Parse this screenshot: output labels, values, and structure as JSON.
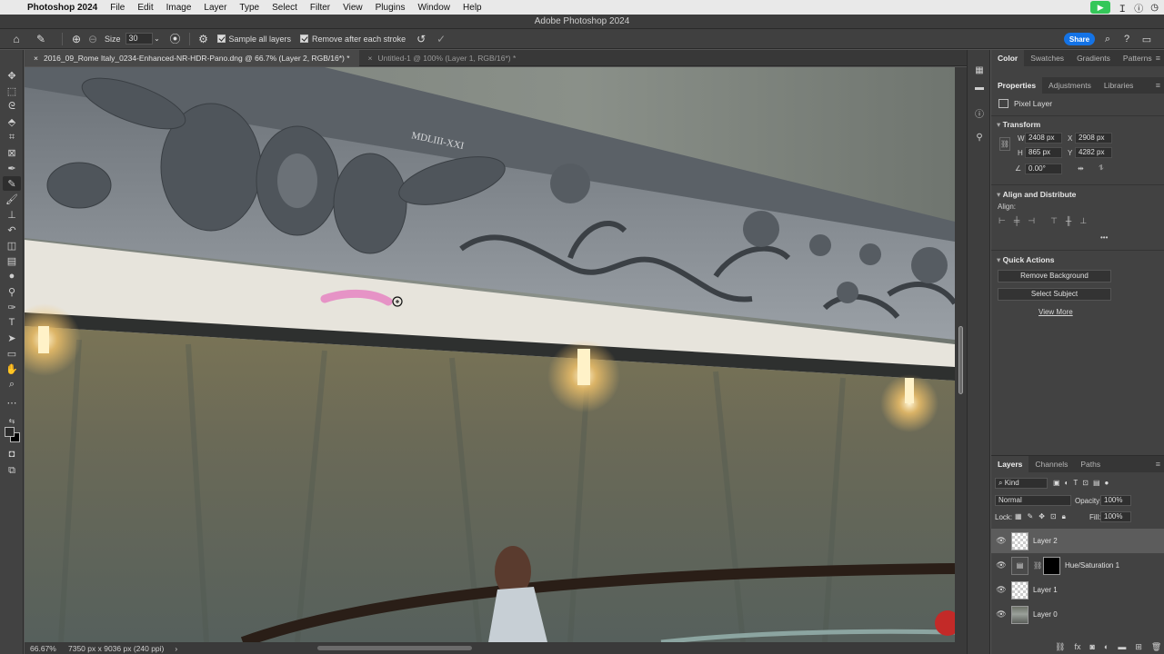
{
  "menubar": {
    "app_name": "Photoshop 2024",
    "items": [
      "File",
      "Edit",
      "Image",
      "Layer",
      "Type",
      "Select",
      "Filter",
      "View",
      "Plugins",
      "Window",
      "Help"
    ]
  },
  "window_title": "Adobe Photoshop 2024",
  "options_bar": {
    "size_label": "Size",
    "size_value": "30",
    "sample_all_layers": "Sample all layers",
    "remove_after_stroke": "Remove after each stroke",
    "share_label": "Share"
  },
  "doc_tabs": [
    {
      "label": "2016_09_Rome Italy_0234-Enhanced-NR-HDR-Pano.dng @ 66.7% (Layer 2, RGB/16*) *"
    },
    {
      "label": "Untitled-1 @ 100% (Layer 1, RGB/16*) *"
    }
  ],
  "status": {
    "zoom": "66.67%",
    "doc_info": "7350 px x 9036 px (240 ppi)"
  },
  "top_panel_tabs": [
    "Color",
    "Swatches",
    "Gradients",
    "Patterns"
  ],
  "props_tabs": [
    "Properties",
    "Adjustments",
    "Libraries"
  ],
  "properties": {
    "layer_kind": "Pixel Layer",
    "transform_title": "Transform",
    "w_label": "W",
    "w_value": "2408 px",
    "h_label": "H",
    "h_value": "865 px",
    "x_label": "X",
    "x_value": "2908 px",
    "y_label": "Y",
    "y_value": "4282 px",
    "angle_value": "0.00°",
    "align_title": "Align and Distribute",
    "align_label": "Align:",
    "quick_actions_title": "Quick Actions",
    "remove_bg": "Remove Background",
    "select_subject": "Select Subject",
    "view_more": "View More"
  },
  "layers_tabs": [
    "Layers",
    "Channels",
    "Paths"
  ],
  "layers_panel": {
    "kind_label": "Kind",
    "blend_mode": "Normal",
    "opacity_label": "Opacity:",
    "opacity_value": "100%",
    "lock_label": "Lock:",
    "fill_label": "Fill:",
    "fill_value": "100%",
    "layers": [
      {
        "name": "Layer 2",
        "selected": true
      },
      {
        "name": "Hue/Saturation 1",
        "selected": false
      },
      {
        "name": "Layer 1",
        "selected": false
      },
      {
        "name": "Layer 0",
        "selected": false
      }
    ]
  },
  "canvas_text": {
    "plaque": "MDLIII-XXI"
  }
}
